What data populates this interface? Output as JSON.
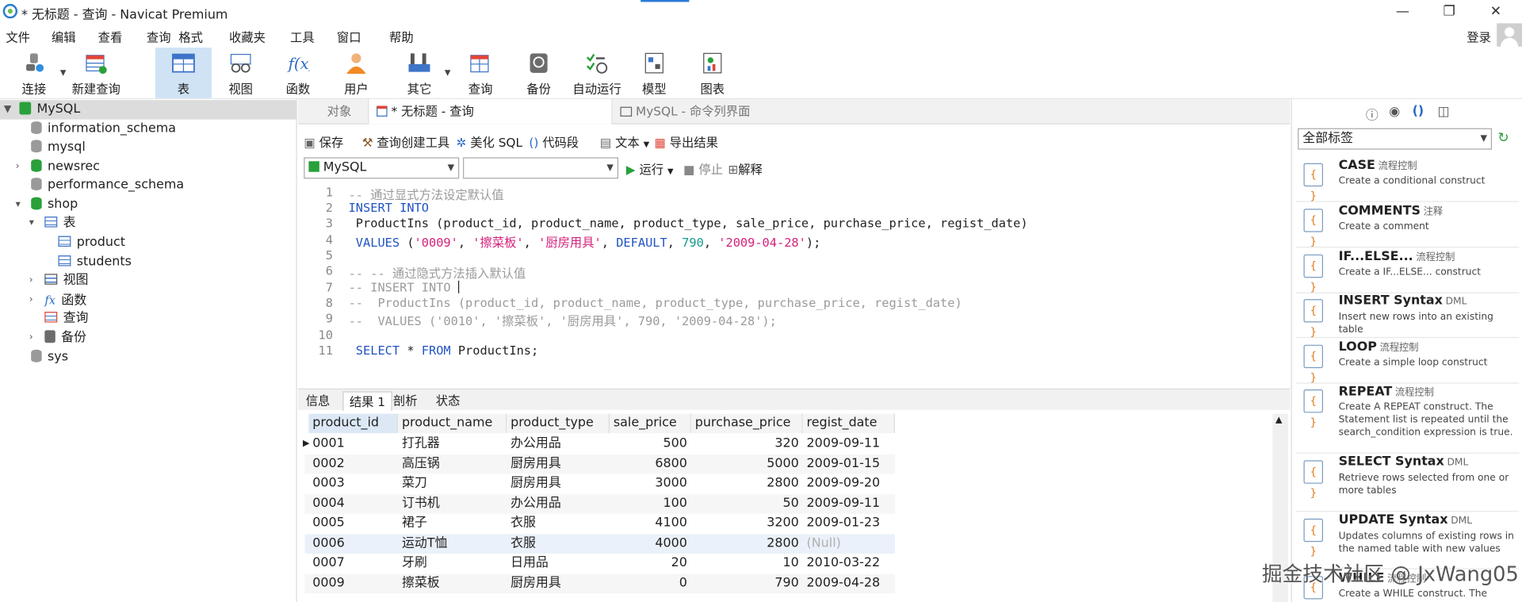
{
  "window": {
    "title": "* 无标题 - 查询 - Navicat Premium",
    "minimize": "—",
    "maximize": "❐",
    "close": "✕"
  },
  "menu": [
    "文件",
    "编辑",
    "查看",
    "查询",
    "格式",
    "收藏夹",
    "工具",
    "窗口",
    "帮助"
  ],
  "login": "登录",
  "toolbar": [
    {
      "label": "连接",
      "icon": "plug-icon"
    },
    {
      "label": "新建查询",
      "icon": "new-query-icon"
    },
    {
      "label": "表",
      "icon": "table-icon",
      "active": true
    },
    {
      "label": "视图",
      "icon": "view-icon"
    },
    {
      "label": "函数",
      "icon": "function-icon"
    },
    {
      "label": "用户",
      "icon": "user-icon"
    },
    {
      "label": "其它",
      "icon": "tools-icon"
    },
    {
      "label": "查询",
      "icon": "query-icon"
    },
    {
      "label": "备份",
      "icon": "backup-icon"
    },
    {
      "label": "自动运行",
      "icon": "schedule-icon"
    },
    {
      "label": "模型",
      "icon": "model-icon"
    },
    {
      "label": "图表",
      "icon": "chart-icon"
    }
  ],
  "tree": {
    "connection": "MySQL",
    "items": [
      "information_schema",
      "mysql",
      "newsrec",
      "performance_schema",
      "shop",
      "表",
      "product",
      "students",
      "视图",
      "函数",
      "查询",
      "备份",
      "sys"
    ]
  },
  "tabs": {
    "objects": "对象",
    "query": "* 无标题 - 查询",
    "console": "MySQL - 命令列界面"
  },
  "query_toolbar": {
    "save": "保存",
    "builder": "查询创建工具",
    "beautify": "美化 SQL",
    "snippet": "代码段",
    "text": "文本",
    "export": "导出结果"
  },
  "run_bar": {
    "connection": "MySQL",
    "database": "",
    "run": "运行",
    "stop": "停止",
    "explain": "解释"
  },
  "editor": {
    "line_numbers": [
      "1",
      "2",
      "3",
      "4",
      "5",
      "6",
      "7",
      "8",
      "9",
      "10",
      "11"
    ],
    "l1": "-- 通过显式方法设定默认值",
    "l2": "INSERT INTO",
    "l3": " ProductIns (product_id, product_name, product_type, sale_price, purchase_price, regist_date)",
    "l4_kw": " VALUES",
    "l4_a": " (",
    "l4_s1": "'0009'",
    "l4_c1": ", ",
    "l4_s2": "'擦菜板'",
    "l4_c2": ", ",
    "l4_s3": "'厨房用具'",
    "l4_c3": ", ",
    "l4_kw2": "DEFAULT",
    "l4_c4": ", ",
    "l4_n1": "790",
    "l4_c5": ", ",
    "l4_s4": "'2009-04-28'",
    "l4_end": ");",
    "l6": "-- -- 通过隐式方法插入默认值",
    "l7": "-- INSERT INTO ",
    "l8": "--  ProductIns (product_id, product_name, product_type, purchase_price, regist_date)",
    "l9": "--  VALUES ('0010', '擦菜板', '厨房用具', 790, '2009-04-28');",
    "l11_kw1": " SELECT",
    "l11_a": " * ",
    "l11_kw2": "FROM",
    "l11_b": " ProductIns;"
  },
  "result_tabs": [
    "信息",
    "结果 1",
    "剖析",
    "状态"
  ],
  "grid": {
    "columns": [
      "product_id",
      "product_name",
      "product_type",
      "sale_price",
      "purchase_price",
      "regist_date"
    ],
    "rows": [
      [
        "0001",
        "打孔器",
        "办公用品",
        "500",
        "320",
        "2009-09-11"
      ],
      [
        "0002",
        "高压锅",
        "厨房用具",
        "6800",
        "5000",
        "2009-01-15"
      ],
      [
        "0003",
        "菜刀",
        "厨房用具",
        "3000",
        "2800",
        "2009-09-20"
      ],
      [
        "0004",
        "订书机",
        "办公用品",
        "100",
        "50",
        "2009-09-11"
      ],
      [
        "0005",
        "裙子",
        "衣服",
        "4100",
        "3200",
        "2009-01-23"
      ],
      [
        "0006",
        "运动T恤",
        "衣服",
        "4000",
        "2800",
        "(Null)"
      ],
      [
        "0007",
        "牙刷",
        "日用品",
        "20",
        "10",
        "2010-03-22"
      ],
      [
        "0009",
        "擦菜板",
        "厨房用具",
        "0",
        "790",
        "2009-04-28"
      ]
    ]
  },
  "right_panel": {
    "filter": "全部标签",
    "snippets": [
      {
        "title": "CASE",
        "tag": "流程控制",
        "desc": "Create a conditional construct"
      },
      {
        "title": "COMMENTS",
        "tag": "注释",
        "desc": "Create a comment"
      },
      {
        "title": "IF...ELSE...",
        "tag": "流程控制",
        "desc": "Create a IF...ELSE... construct"
      },
      {
        "title": "INSERT Syntax",
        "tag": "DML",
        "desc": "Insert new rows into an existing table"
      },
      {
        "title": "LOOP",
        "tag": "流程控制",
        "desc": "Create a simple loop construct"
      },
      {
        "title": "REPEAT",
        "tag": "流程控制",
        "desc": "Create A REPEAT construct. The Statement list is repeated until the search_condition expression is true."
      },
      {
        "title": "SELECT Syntax",
        "tag": "DML",
        "desc": "Retrieve rows selected from one or more tables"
      },
      {
        "title": "UPDATE Syntax",
        "tag": "DML",
        "desc": "Updates columns of existing rows in the named table with new values"
      },
      {
        "title": "WHILE",
        "tag": "流程控制",
        "desc": "Create a WHILE construct. The statement"
      }
    ]
  },
  "watermark": "掘金技术社区 @ JxWang05"
}
